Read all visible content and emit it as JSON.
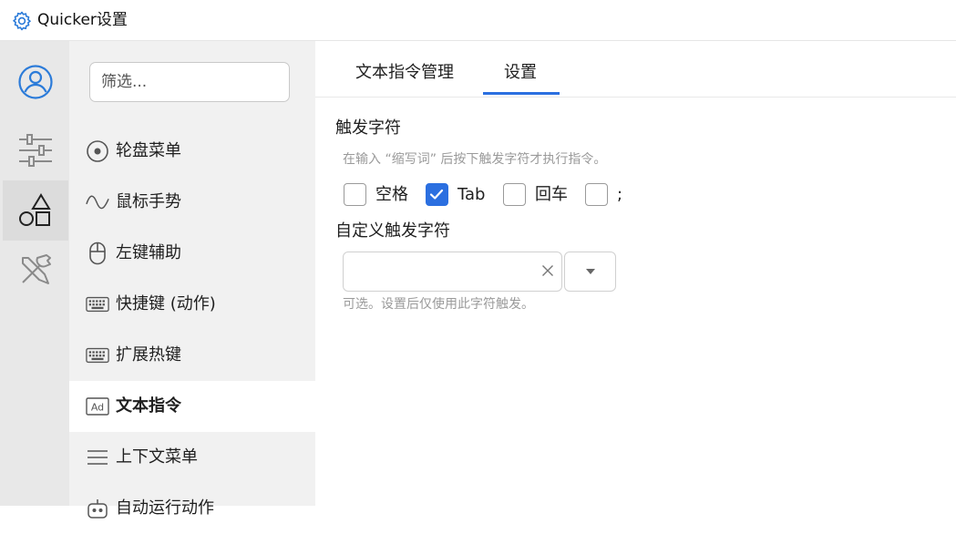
{
  "window": {
    "title": "Quicker设置",
    "app_icon": "gear-icon"
  },
  "rail": {
    "items": [
      {
        "name": "user-profile",
        "icon": "user-circle-icon"
      },
      {
        "name": "settings-sliders",
        "icon": "sliders-icon"
      },
      {
        "name": "shapes",
        "icon": "shapes-icon",
        "active": true
      },
      {
        "name": "tools",
        "icon": "tools-icon"
      }
    ]
  },
  "sidebar": {
    "filter_placeholder": "筛选...",
    "items": [
      {
        "label": "轮盘菜单",
        "icon": "wheel-icon"
      },
      {
        "label": "鼠标手势",
        "icon": "wave-icon"
      },
      {
        "label": "左键辅助",
        "icon": "mouse-icon"
      },
      {
        "label": "快捷键 (动作)",
        "icon": "keyboard-icon"
      },
      {
        "label": "扩展热键",
        "icon": "keyboard-icon"
      },
      {
        "label": "文本指令",
        "icon": "ad-icon",
        "selected": true
      },
      {
        "label": "上下文菜单",
        "icon": "menu-lines-icon"
      },
      {
        "label": "自动运行动作",
        "icon": "robot-icon"
      }
    ]
  },
  "tabs": {
    "items": [
      {
        "label": "文本指令管理"
      },
      {
        "label": "设置",
        "active": true
      }
    ]
  },
  "settings": {
    "trigger": {
      "title": "触发字符",
      "hint": "在输入 “缩写词” 后按下触发字符才执行指令。",
      "options": [
        {
          "label": "空格",
          "checked": false
        },
        {
          "label": "Tab",
          "checked": true
        },
        {
          "label": "回车",
          "checked": false
        },
        {
          "label": ";",
          "checked": false
        }
      ]
    },
    "custom": {
      "title": "自定义触发字符",
      "value": "",
      "hint": "可选。设置后仅使用此字符触发。"
    }
  },
  "colors": {
    "accent": "#2b6fe0",
    "rail_bg": "#e8e8e8",
    "sidebar_bg": "#f1f1f1"
  }
}
